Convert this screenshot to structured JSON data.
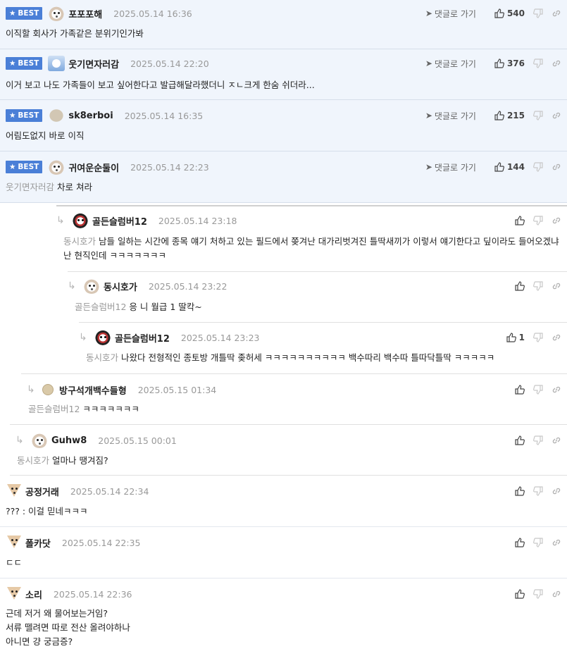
{
  "ui": {
    "best_label": "BEST",
    "reply_link_label": "댓글로 가기"
  },
  "comments": [
    {
      "nick": "포포포해",
      "date": "2025.05.14 16:36",
      "text": "이직할 회사가 가족같은 분위기인가봐",
      "likes": "540",
      "best": true,
      "avatar": "dog"
    },
    {
      "nick": "웃기면자러감",
      "date": "2025.05.14 22:20",
      "text": "이거 보고 나도 가족들이 보고 싶어한다고 발급해달라했더니 ㅈㄴ크게 한숨 쉬더라...",
      "likes": "376",
      "best": true,
      "avatar": "blue"
    },
    {
      "nick": "sk8erboi",
      "date": "2025.05.14 16:35",
      "text": "어림도없지 바로 이직",
      "likes": "215",
      "best": true,
      "avatar": "stone"
    },
    {
      "nick": "귀여운순둘이",
      "date": "2025.05.14 22:23",
      "target": "웃기면자러감",
      "text": "차로 쳐라",
      "likes": "144",
      "best": true,
      "avatar": "dog"
    },
    {
      "nick": "골든슬럼버12",
      "date": "2025.05.14 23:18",
      "target": "동시호가",
      "text": "남들 일하는 시간에 종목 얘기 처하고 있는 필드에서 쫒겨난 대가리벗겨진 틀딱새끼가 이렇서 얘기한다고 딮이라도 들어오겠냐 난 현직인데 ㅋㅋㅋㅋㅋㅋㅋ",
      "likes": "",
      "avatar": "dark"
    },
    {
      "nick": "동시호가",
      "date": "2025.05.14 23:22",
      "target": "골든슬럼버12",
      "text": "응 니 월급 1 딸칵~",
      "likes": "",
      "avatar": "dog"
    },
    {
      "nick": "골든슬럼버12",
      "date": "2025.05.14 23:23",
      "target": "동시호가",
      "text": "나왔다 전형적인 종토방 개틀딱 좆허세 ㅋㅋㅋㅋㅋㅋㅋㅋㅋㅋ 백수따리 백수따 틀따닥틀딱 ㅋㅋㅋㅋㅋ",
      "likes": "1",
      "avatar": "dark"
    },
    {
      "nick": "방구석개백수들형",
      "date": "2025.05.15 01:34",
      "target": "골든슬럼버12",
      "text": "ㅋㅋㅋㅋㅋㅋㅋ",
      "likes": "",
      "avatar": "ball"
    },
    {
      "nick": "Guhw8",
      "date": "2025.05.15 00:01",
      "target": "동시호가",
      "text": "얼마나 땡겨짐?",
      "likes": "",
      "avatar": "dog"
    },
    {
      "nick": "공정거래",
      "date": "2025.05.14 22:34",
      "text": "??? : 이걸 믿네ㅋㅋㅋ",
      "likes": "",
      "avatar": "chihuahua"
    },
    {
      "nick": "폴카닷",
      "date": "2025.05.14 22:35",
      "text": "ㄷㄷ",
      "likes": "",
      "avatar": "chihuahua"
    },
    {
      "nick": "소리",
      "date": "2025.05.14 22:36",
      "text_lines": [
        "근데 저거 왜 물어보는거임?",
        "서류 뗄려면 따로 전산 올려야하나",
        "아니면 걍 궁금증?"
      ],
      "likes": "",
      "avatar": "chihuahua"
    }
  ]
}
